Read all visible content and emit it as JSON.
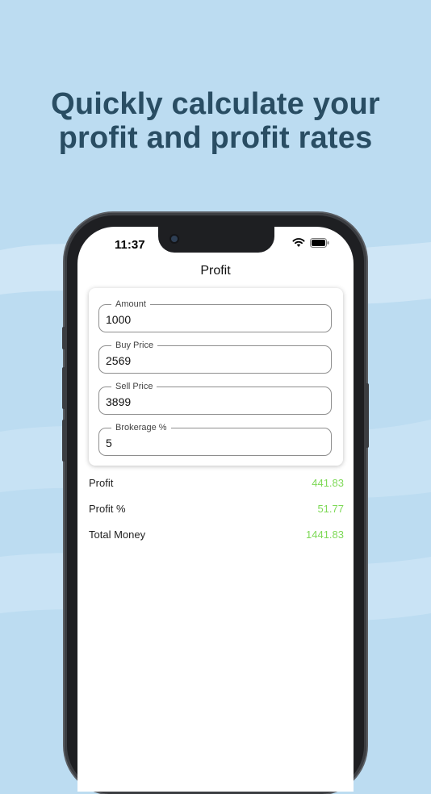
{
  "headline": {
    "line1": "Quickly calculate your",
    "line2": "profit and profit rates"
  },
  "status_bar": {
    "time": "11:37",
    "icons": [
      "wifi-icon",
      "battery-icon"
    ]
  },
  "nav": {
    "title": "Profit"
  },
  "form": {
    "fields": [
      {
        "label": "Amount",
        "value": "1000"
      },
      {
        "label": "Buy Price",
        "value": "2569"
      },
      {
        "label": "Sell Price",
        "value": "3899"
      },
      {
        "label": "Brokerage %",
        "value": "5"
      }
    ]
  },
  "results": [
    {
      "label": "Profit",
      "value": "441.83"
    },
    {
      "label": "Profit %",
      "value": "51.77"
    },
    {
      "label": "Total Money",
      "value": "1441.83"
    }
  ],
  "colors": {
    "background": "#bcdcf1",
    "headline": "#294d63",
    "result_value": "#7ed957"
  }
}
